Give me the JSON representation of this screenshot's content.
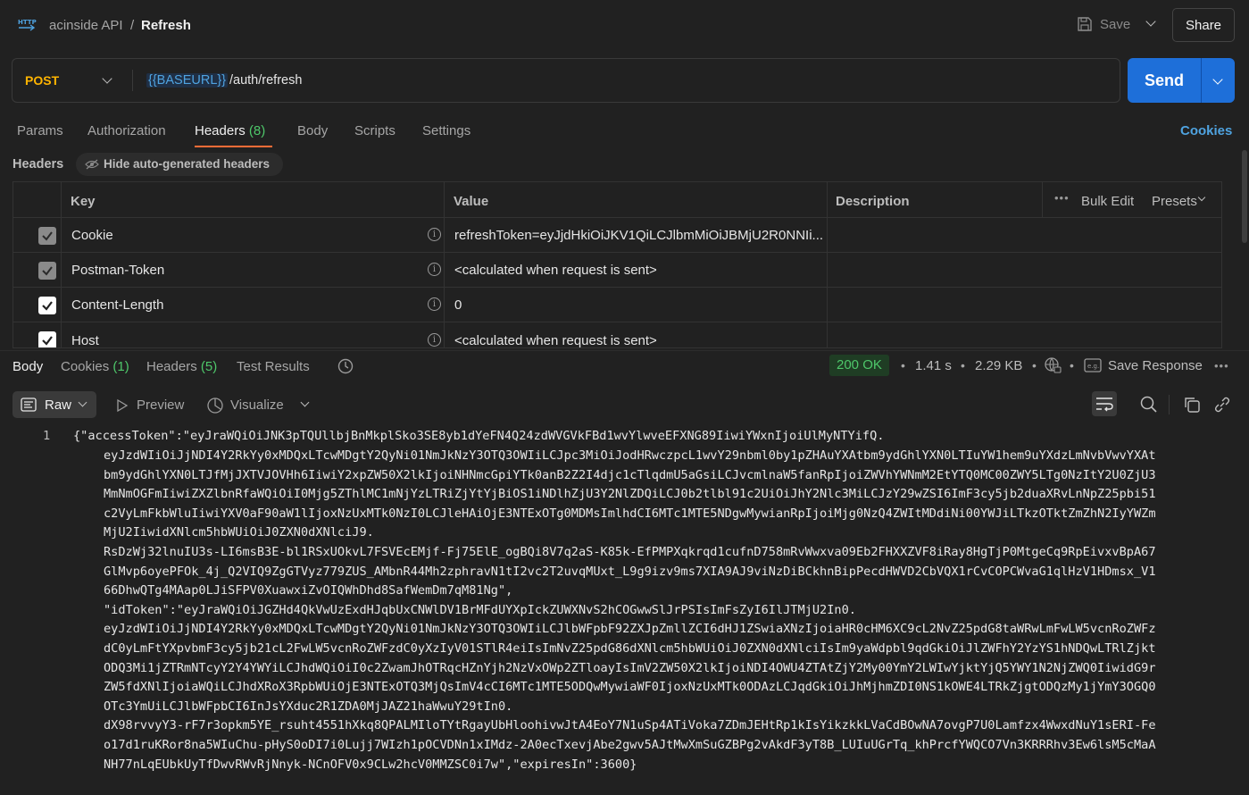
{
  "header": {
    "workspace": "acinside API",
    "separator": "/",
    "request_name": "Refresh",
    "save_label": "Save",
    "share_label": "Share"
  },
  "request": {
    "method": "POST",
    "url_variable": "{{BASEURL}}",
    "url_path": "/auth/refresh",
    "send_label": "Send"
  },
  "request_tabs": {
    "params": "Params",
    "authorization": "Authorization",
    "headers": "Headers",
    "headers_count": "(8)",
    "body": "Body",
    "scripts": "Scripts",
    "settings": "Settings",
    "cookies": "Cookies"
  },
  "headers_section": {
    "title": "Headers",
    "hide_auto": "Hide auto-generated headers",
    "columns": {
      "key": "Key",
      "value": "Value",
      "description": "Description"
    },
    "bulk_edit": "Bulk Edit",
    "presets": "Presets",
    "rows": [
      {
        "key": "Cookie",
        "value": "refreshToken=eyJjdHkiOiJKV1QiLCJlbmMiOiJBMjU2R0NNIi...",
        "checked_style": "auto"
      },
      {
        "key": "Postman-Token",
        "value": "<calculated when request is sent>",
        "checked_style": "auto"
      },
      {
        "key": "Content-Length",
        "value": "0",
        "checked_style": "on"
      },
      {
        "key": "Host",
        "value": "<calculated when request is sent>",
        "checked_style": "on"
      }
    ]
  },
  "response_tabs": {
    "body": "Body",
    "cookies": "Cookies",
    "cookies_count": "(1)",
    "headers": "Headers",
    "headers_count": "(5)",
    "test_results": "Test Results"
  },
  "response_meta": {
    "status": "200 OK",
    "time": "1.41 s",
    "size": "2.29 KB",
    "save_response": "Save Response"
  },
  "response_toolbar": {
    "raw": "Raw",
    "preview": "Preview",
    "visualize": "Visualize"
  },
  "response_body": {
    "line_number": "1",
    "lines": [
      "{\"accessToken\":\"eyJraWQiOiJNK3pTQUllbjBnMkplSko3SE8yb1dYeFN4Q24zdWVGVkFBd1wvYlwveEFXNG89IiwiYWxnIjoiUlMyNTYifQ."
    ],
    "continuation": [
      "eyJzdWIiOiJjNDI4Y2RkYy0xMDQxLTcwMDgtY2QyNi01NmJkNzY3OTQ3OWIiLCJpc3MiOiJodHRwczpcL1wvY29nbml0by1pZHAuYXAtbm9ydGhlYXN0LTIuYW1hem9uYXdzLmNvbVwvYXAt",
      "bm9ydGhlYXN0LTJfMjJXTVJOVHh6IiwiY2xpZW50X2lkIjoiNHNmcGpiYTk0anB2Z2I4djc1cTlqdmU5aGsiLCJvcmlnaW5fanRpIjoiZWVhYWNmM2EtYTQ0MC00ZWY5LTg0NzItY2U0ZjU3",
      "MmNmOGFmIiwiZXZlbnRfaWQiOiI0Mjg5ZThlMC1mNjYzLTRiZjYtYjBiOS1iNDlhZjU3Y2NlZDQiLCJ0b2tlbl91c2UiOiJhY2Nlc3MiLCJzY29wZSI6ImF3cy5jb2duaXRvLnNpZ25pbi51",
      "c2VyLmFkbWluIiwiYXV0aF90aW1lIjoxNzUxMTk0NzI0LCJleHAiOjE3NTExOTg0MDMsImlhdCI6MTc1MTE5NDgwMywianRpIjoiMjg0NzQ4ZWItMDdiNi00YWJiLTkzOTktZmZhN2IyYWZm",
      "MjU2IiwidXNlcm5hbWUiOiJ0ZXN0dXNlciJ9.",
      "RsDzWj32lnuIU3s-LI6msB3E-bl1RSxUOkvL7FSVEcEMjf-Fj75ElE_ogBQi8V7q2aS-K85k-EfPMPXqkrqd1cufnD758mRvWwxva09Eb2FHXXZVF8iRay8HgTjP0MtgeCq9RpEivxvBpA67",
      "GlMvp6oyePFOk_4j_Q2VIQ9ZgGTVyz779ZUS_AMbnR44Mh2zphravN1tI2vc2T2uvqMUxt_L9g9izv9ms7XIA9AJ9viNzDiBCkhnBipPecdHWVD2CbVQX1rCvCOPCWvaG1qlHzV1HDmsx_V1",
      "66DhwQTg4MAap0LJiSFPV0XuawxiZvOIQWhDhd8SafWemDm7qM81Ng\",",
      "\"idToken\":\"eyJraWQiOiJGZHd4QkVwUzExdHJqbUxCNWlDV1BrMFdUYXpIckZUWXNvS2hCOGwwSlJrPSIsImFsZyI6IlJTMjU2In0.",
      "eyJzdWIiOiJjNDI4Y2RkYy0xMDQxLTcwMDgtY2QyNi01NmJkNzY3OTQ3OWIiLCJlbWFpbF92ZXJpZmllZCI6dHJ1ZSwiaXNzIjoiaHR0cHM6XC9cL2NvZ25pdG8taWRwLmFwLW5vcnRoZWFz",
      "dC0yLmFtYXpvbmF3cy5jb21cL2FwLW5vcnRoZWFzdC0yXzIyV01STlR4eiIsImNvZ25pdG86dXNlcm5hbWUiOiJ0ZXN0dXNlciIsIm9yaWdpbl9qdGkiOiJlZWFhY2YzYS1hNDQwLTRlZjkt",
      "ODQ3Mi1jZTRmNTcyY2Y4YWYiLCJhdWQiOiI0c2ZwamJhOTRqcHZnYjh2NzVxOWp2ZTloayIsImV2ZW50X2lkIjoiNDI4OWU4ZTAtZjY2My00YmY2LWIwYjktYjQ5YWY1N2NjZWQ0IiwidG9r",
      "ZW5fdXNlIjoiaWQiLCJhdXRoX3RpbWUiOjE3NTExOTQ3MjQsImV4cCI6MTc1MTE5ODQwMywiaWF0IjoxNzUxMTk0ODAzLCJqdGkiOiJhMjhmZDI0NS1kOWE4LTRkZjgtODQzMy1jYmY3OGQ0",
      "OTc3YmUiLCJlbWFpbCI6InJsYXduc2R1ZDA0MjJAZ21haWwuY29tIn0.",
      "dX98rvvyY3-rF7r3opkm5YE_rsuht4551hXkq8QPALMIloTYtRgayUbHloohivwJtA4EoY7N1uSp4ATiVoka7ZDmJEHtRp1kIsYikzkkLVaCdBOwNA7ovgP7U0Lamfzx4WwxdNuY1sERI-Fe",
      "o17d1ruKRor8na5WIuChu-pHyS0oDI7i0Lujj7WIzh1pOCVDNn1xIMdz-2A0ecTxevjAbe2gwv5AJtMwXmSuGZBPg2vAkdF3yT8B_LUIuUGrTq_khPrcfYWQCO7Vn3KRRRhv3Ew6lsM5cMaA",
      "NH77nLqEUbkUyTfDwvRWvRjNnyk-NCnOFV0x9CLw2hcV0MMZSC0i7w\",\"expiresIn\":3600}"
    ]
  }
}
